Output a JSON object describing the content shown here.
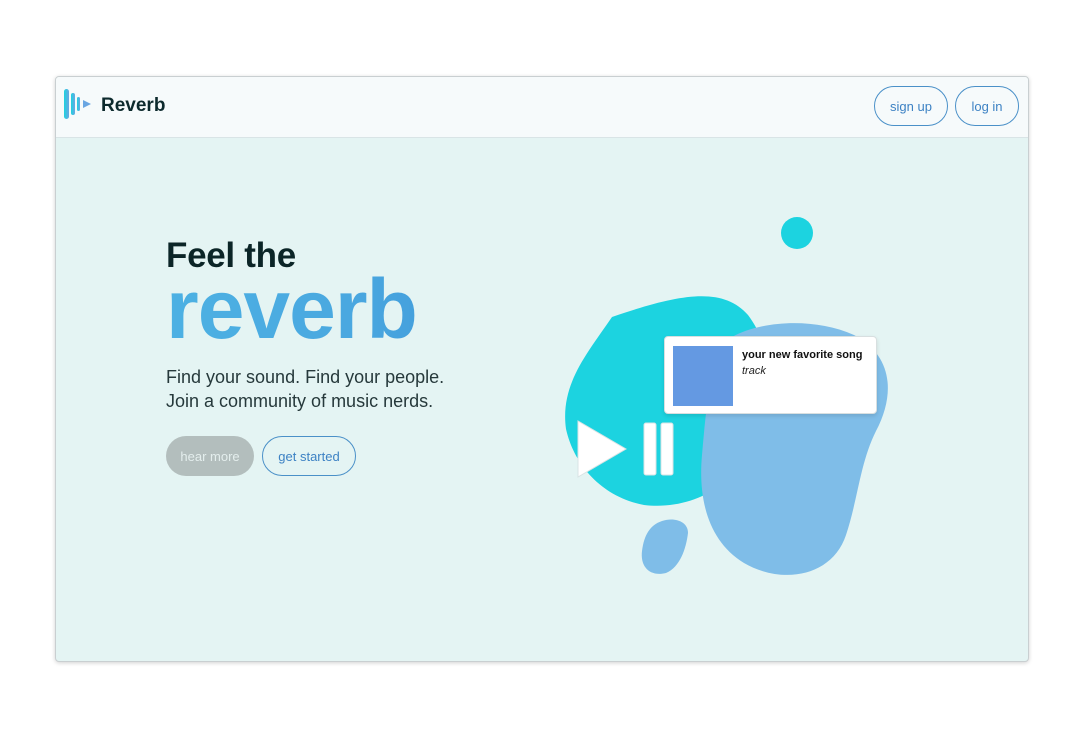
{
  "app": {
    "name": "Reverb",
    "colors": {
      "accent_teal": "#1cd3e0",
      "accent_blue": "#7fbde8",
      "background": "#e4f4f3",
      "nav_background": "#f6fafb",
      "link_blue": "#3d82c4",
      "album_blue": "#6499e2"
    }
  },
  "nav": {
    "logo_icon": "sound-wave-play-icon",
    "signup_label": "sign up",
    "login_label": "log in"
  },
  "hero": {
    "heading_small": "Feel the",
    "heading_big": "reverb",
    "tagline_line1": "Find your sound. Find your people.",
    "tagline_line2": "Join a community of music nerds.",
    "hear_more_label": "hear more",
    "get_started_label": "get started"
  },
  "player_preview": {
    "track_title": "your new favorite song",
    "track_type": "track",
    "play_icon": "play-icon",
    "pause_icon": "pause-icon"
  }
}
